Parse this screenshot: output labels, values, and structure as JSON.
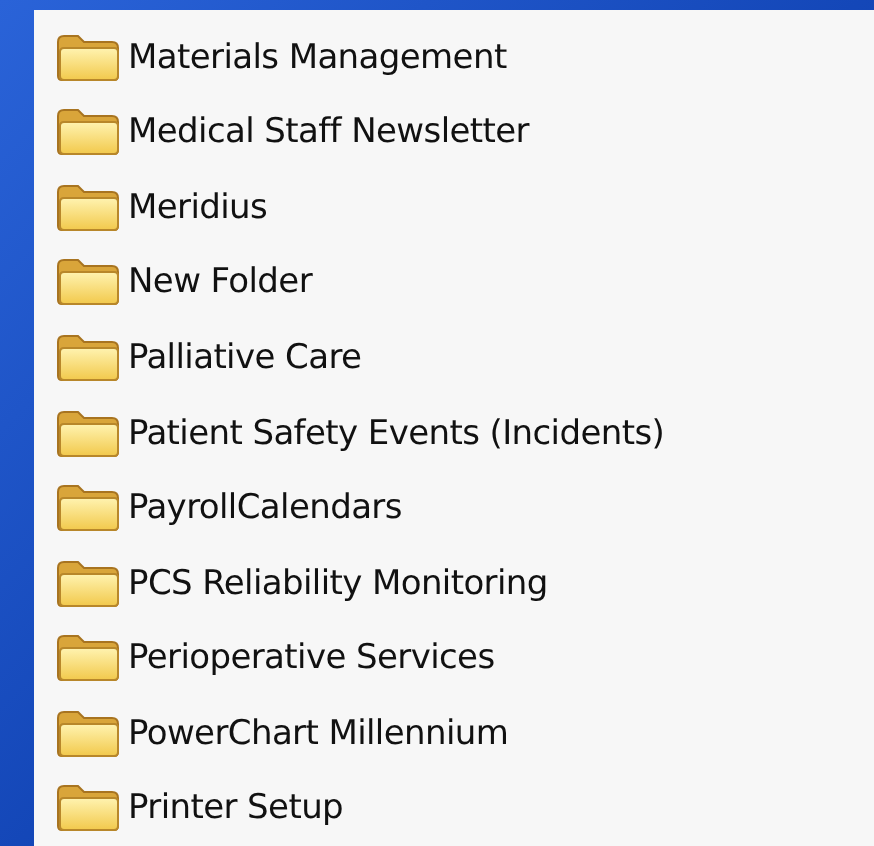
{
  "folders": [
    {
      "name": "Materials Management"
    },
    {
      "name": "Medical Staff Newsletter"
    },
    {
      "name": "Meridius"
    },
    {
      "name": "New Folder"
    },
    {
      "name": "Palliative Care"
    },
    {
      "name": "Patient Safety Events (Incidents)"
    },
    {
      "name": "PayrollCalendars"
    },
    {
      "name": "PCS Reliability Monitoring"
    },
    {
      "name": "Perioperative Services"
    },
    {
      "name": "PowerChart Millennium"
    },
    {
      "name": "Printer Setup"
    }
  ]
}
